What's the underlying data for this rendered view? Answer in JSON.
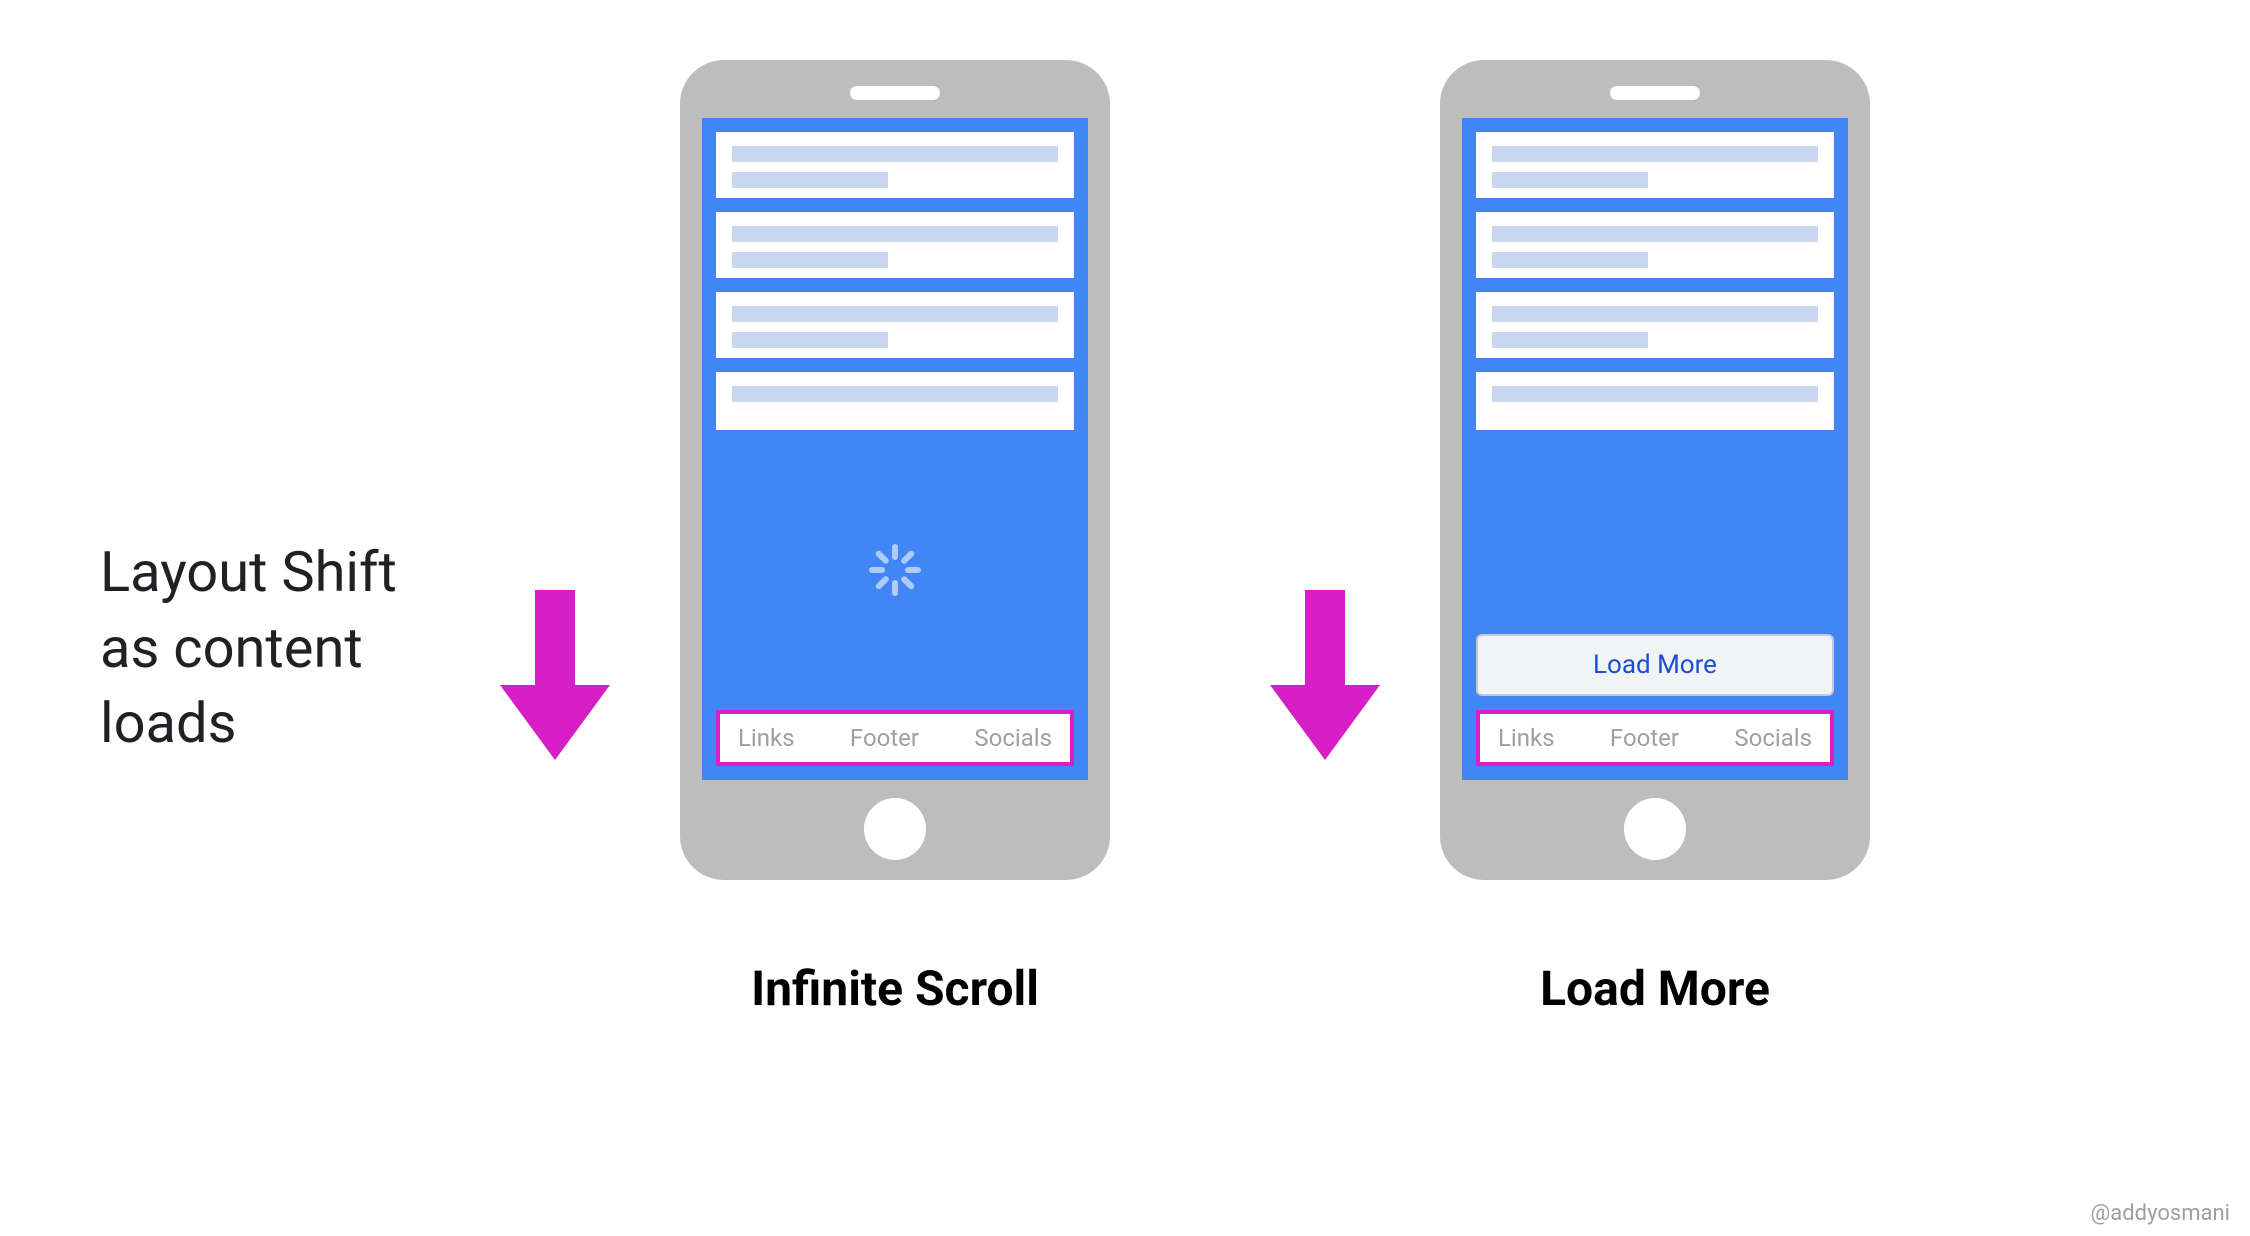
{
  "label": {
    "line1": "Layout Shift",
    "line2": "as content",
    "line3": "loads"
  },
  "phone1": {
    "footer": {
      "links": "Links",
      "footer": "Footer",
      "socials": "Socials"
    },
    "caption": "Infinite Scroll"
  },
  "phone2": {
    "button": "Load More",
    "footer": {
      "links": "Links",
      "footer": "Footer",
      "socials": "Socials"
    },
    "caption": "Load More"
  },
  "credit": "@addyosmani",
  "colors": {
    "accent_blue": "#4285f4",
    "highlight_magenta": "#d61fc7",
    "device_gray": "#bdbdbd",
    "bar_fill": "#c9d6ef"
  }
}
